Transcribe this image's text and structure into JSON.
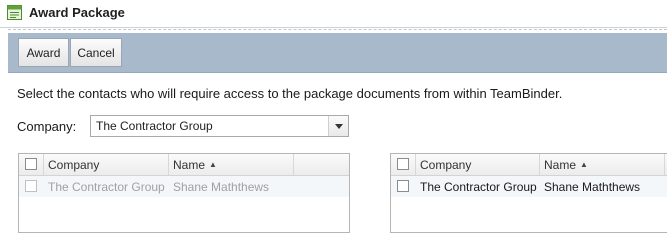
{
  "window": {
    "title": "Award Package",
    "icon": "form-icon"
  },
  "toolbar": {
    "award_label": "Award",
    "cancel_label": "Cancel"
  },
  "instructions": "Select the contacts who will require access to the package documents from within TeamBinder.",
  "company_filter": {
    "label": "Company:",
    "selected": "The Contractor Group"
  },
  "available_grid": {
    "columns": [
      "Company",
      "Name"
    ],
    "sort_indicator": "▲",
    "rows": [
      {
        "company": "The Contractor Group",
        "name": "Shane Maththews",
        "checked": false,
        "disabled": true
      }
    ]
  },
  "selected_grid": {
    "columns": [
      "Company",
      "Name"
    ],
    "sort_indicator": "▲",
    "rows": [
      {
        "company": "The Contractor Group",
        "name": "Shane Maththews",
        "checked": false
      }
    ]
  },
  "colors": {
    "toolbar_bg": "#a8b9cc",
    "disabled_text": "#a0a0a0"
  }
}
